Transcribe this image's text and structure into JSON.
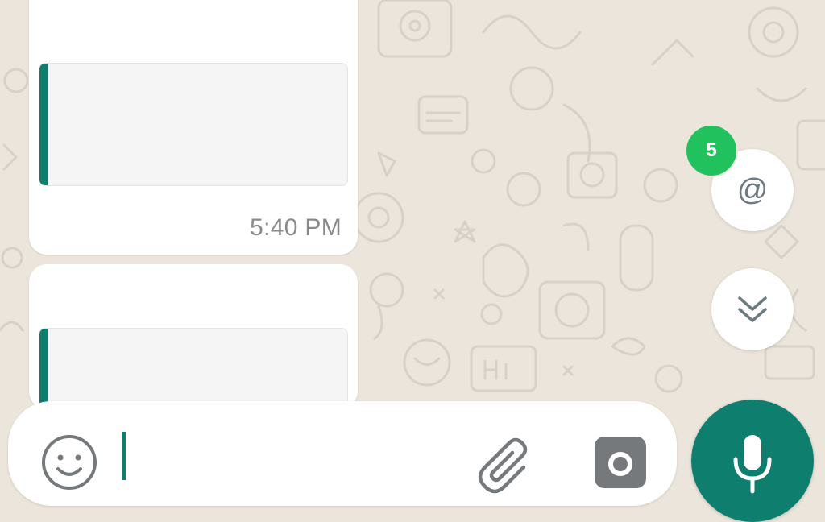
{
  "chat": {
    "messages": [
      {
        "time": "5:40 PM"
      },
      {
        "time": ""
      }
    ]
  },
  "floating": {
    "mention_badge_count": "5",
    "mention_symbol": "@"
  },
  "composer": {
    "input_value": "",
    "input_placeholder": ""
  },
  "colors": {
    "wallpaper": "#ece5dc",
    "accent_teal": "#0e7f6e",
    "badge_green": "#21c25e",
    "muted_gray": "#8a8a8a"
  },
  "icons": {
    "emoji": "emoji-icon",
    "attach": "paperclip-icon",
    "camera": "camera-icon",
    "mic": "mic-icon",
    "scroll_down": "double-chevron-down-icon"
  }
}
